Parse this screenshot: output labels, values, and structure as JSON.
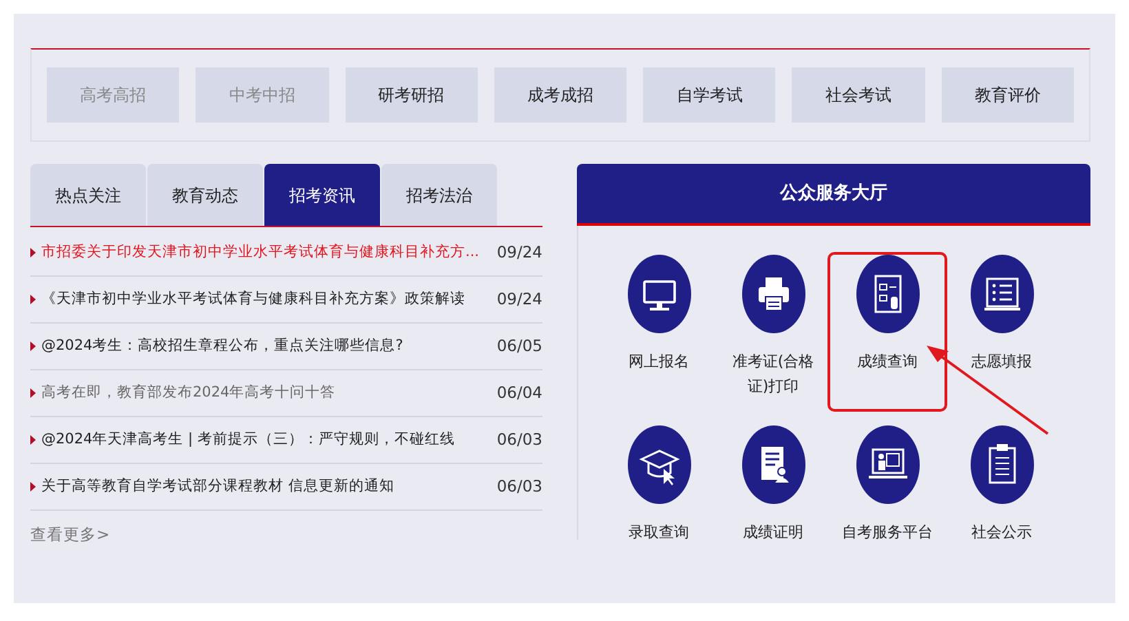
{
  "categories": [
    {
      "label": "高考高招",
      "muted": true
    },
    {
      "label": "中考中招",
      "muted": true
    },
    {
      "label": "研考研招",
      "muted": false
    },
    {
      "label": "成考成招",
      "muted": false
    },
    {
      "label": "自学考试",
      "muted": false
    },
    {
      "label": "社会考试",
      "muted": false
    },
    {
      "label": "教育评价",
      "muted": false
    }
  ],
  "news": {
    "tabs": [
      {
        "label": "热点关注",
        "selected": false
      },
      {
        "label": "教育动态",
        "selected": false
      },
      {
        "label": "招考资讯",
        "selected": true
      },
      {
        "label": "招考法治",
        "selected": false
      }
    ],
    "items": [
      {
        "title": "市招委关于印发天津市初中学业水平考试体育与健康科目补充方...",
        "date": "09/24",
        "kind": "highlight"
      },
      {
        "title": "《天津市初中学业水平考试体育与健康科目补充方案》政策解读",
        "date": "09/24",
        "kind": "normal"
      },
      {
        "title": "@2024考生：高校招生章程公布，重点关注哪些信息?",
        "date": "06/05",
        "kind": "normal"
      },
      {
        "title": "高考在即，教育部发布2024年高考十问十答",
        "date": "06/04",
        "kind": "visited"
      },
      {
        "title": "@2024年天津高考生 | 考前提示（三）：严守规则，不碰红线",
        "date": "06/03",
        "kind": "normal"
      },
      {
        "title": "关于高等教育自学考试部分课程教材 信息更新的通知",
        "date": "06/03",
        "kind": "normal"
      }
    ],
    "more": "查看更多>"
  },
  "service_hall": {
    "title": "公众服务大厅",
    "items": [
      {
        "label": "网上报名",
        "highlighted": false
      },
      {
        "label": "准考证(合格证)打印",
        "highlighted": false
      },
      {
        "label": "成绩查询",
        "highlighted": true
      },
      {
        "label": "志愿填报",
        "highlighted": false
      },
      {
        "label": "录取查询",
        "highlighted": false
      },
      {
        "label": "成绩证明",
        "highlighted": false
      },
      {
        "label": "自考服务平台",
        "highlighted": false
      },
      {
        "label": "社会公示",
        "highlighted": false
      }
    ]
  }
}
